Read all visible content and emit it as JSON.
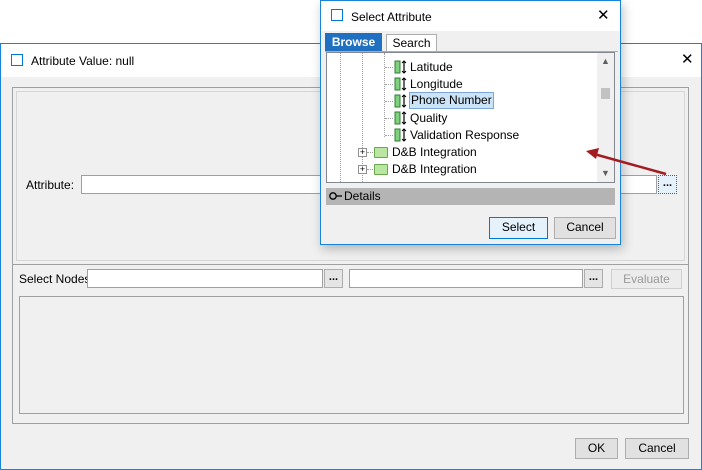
{
  "main": {
    "title": "Attribute Value: null",
    "attribute_label": "Attribute:",
    "attribute_value": "",
    "attribute_browse": "...",
    "select_nodes_label": "Select Nodes",
    "nodes_value_1": "",
    "nodes_browse_1": "...",
    "nodes_value_2": "",
    "nodes_browse_2": "...",
    "evaluate_label": "Evaluate",
    "ok_label": "OK",
    "cancel_label": "Cancel"
  },
  "popup": {
    "title": "Select Attribute",
    "tabs": [
      {
        "label": "Browse",
        "active": true
      },
      {
        "label": "Search",
        "active": false
      }
    ],
    "tree_items": [
      {
        "label": "Latitude",
        "type": "attribute"
      },
      {
        "label": "Longitude",
        "type": "attribute"
      },
      {
        "label": "Phone Number",
        "type": "attribute",
        "selected": true
      },
      {
        "label": "Quality",
        "type": "attribute"
      },
      {
        "label": "Validation Response",
        "type": "attribute"
      },
      {
        "label": "D&B Integration",
        "type": "folder"
      },
      {
        "label": "D&B Integration",
        "type": "folder"
      }
    ],
    "details_label": "Details",
    "select_label": "Select",
    "cancel_label": "Cancel"
  },
  "colors": {
    "accent": "#1f70c1",
    "arrow": "#a31c22",
    "selection": "#cce4f7"
  }
}
